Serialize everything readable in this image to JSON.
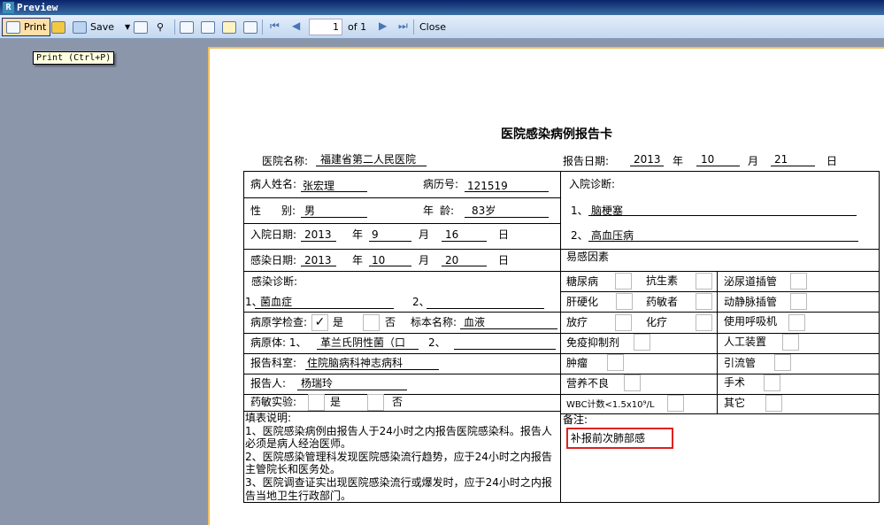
{
  "window": {
    "title": "Preview",
    "icon": "app-r-icon"
  },
  "toolbar": {
    "print": "Print",
    "save": "Save",
    "page": "1",
    "of": "of 1",
    "close": "Close",
    "tooltip": "Print (Ctrl+P)"
  },
  "form": {
    "title": "医院感染病例报告卡",
    "hospital_label": "医院名称:",
    "hospital": "福建省第二人民医院",
    "report_date_label": "报告日期:",
    "report_year": "2013",
    "report_month": "10",
    "report_day": "21",
    "year": "年",
    "month": "月",
    "day": "日",
    "name_label": "病人姓名:",
    "name": "张宏理",
    "record_label": "病历号:",
    "record": "121519",
    "sex_label1": "性",
    "sex_label2": "别:",
    "sex": "男",
    "age_label1": "年",
    "age_label2": "龄:",
    "age": "83岁",
    "admit_label": "入院日期:",
    "admit_year": "2013",
    "admit_month": "9",
    "admit_day": "16",
    "infect_label": "感染日期:",
    "infect_year": "2013",
    "infect_month": "10",
    "infect_day": "20",
    "admit_diag_label": "入院诊断:",
    "admit_diag": [
      {
        "n": "1、",
        "v": "脑梗塞"
      },
      {
        "n": "2、",
        "v": "高血压病"
      }
    ],
    "infect_diag_label": "感染诊断:",
    "infect_diag1_n": "1、",
    "infect_diag1": "菌血症",
    "infect_diag2_n": "2、",
    "path_check_label": "病原学检查:",
    "yes": "是",
    "no": "否",
    "path_check_yes": true,
    "specimen_label": "标本名称:",
    "specimen": "血液",
    "pathogen_label": "病原体: 1、",
    "pathogen1": "革兰氏阴性菌（口",
    "pathogen2_n": "2、",
    "dept_label": "报告科室:",
    "dept": "住院脑病科神志病科",
    "reporter_label": "报告人:",
    "reporter": "杨瑞玲",
    "drug_test_label": "药敏实验:",
    "risk_label": "易感因素",
    "risks": [
      "糖尿病",
      "抗生素",
      "泌尿道插管",
      "肝硬化",
      "药敏者",
      "动静脉插管",
      "放疗",
      "化疗",
      "使用呼吸机",
      "免疫抑制剂",
      "人工装置",
      "肿瘤",
      "引流管",
      "营养不良",
      "手术",
      "WBC计数<1.5x10⁹/L",
      "其它"
    ],
    "instructions": "填表说明:\n1、医院感染病例由报告人于24小时之内报告医院感染科。报告人必须是病人经治医师。\n2、医院感染管理科发现医院感染流行趋势，应于24小时之内报告主管院长和医务处。\n3、医院调查证实出现医院感染流行或爆发时，应于24小时之内报告当地卫生行政部门。",
    "remark_label": "备注:",
    "remark": "补报前次肺部感",
    "remark_highlight_color": "#e02020"
  }
}
